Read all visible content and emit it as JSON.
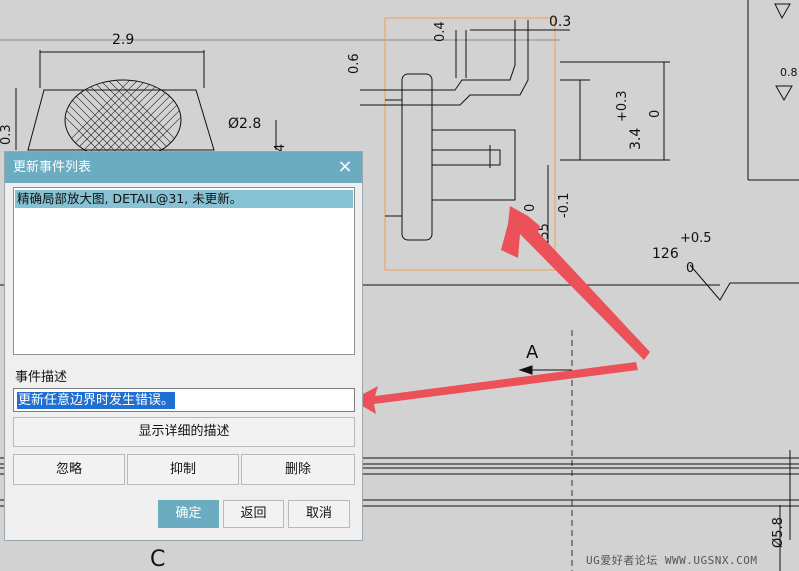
{
  "drawing": {
    "dim_top_width": "2.9",
    "dim_diameter_28": "Ø2.8",
    "dim_03_left": "0.3",
    "dim_04_right": "4",
    "dim_06": "0.6",
    "dim_04": "0.4",
    "dim_03": "0.3",
    "dim_34": "3.4",
    "tol_plus03": "+0.3",
    "tol_zero_a": "0",
    "tol_zero_b": "0",
    "tol_minus01": "-0.1",
    "dim_255": "2.55",
    "dim_126": "126",
    "tol_plus05": "+0.5",
    "tol_zero_c": "0",
    "dim_08": "0.8",
    "section_a": "A",
    "dim_58": "Ø5.8",
    "label_c": "C"
  },
  "dialog": {
    "title": "更新事件列表",
    "close_glyph": "×",
    "events": [
      {
        "text": "精确局部放大图, DETAIL@31, 未更新。"
      }
    ],
    "desc_label": "事件描述",
    "desc_value": "更新任意边界时发生错误。",
    "show_details_label": "显示详细的描述",
    "ignore_label": "忽略",
    "suppress_label": "抑制",
    "delete_label": "删除",
    "ok_label": "确定",
    "back_label": "返回",
    "cancel_label": "取消"
  },
  "watermark": "UG爱好者论坛 WWW.UGSNX.COM",
  "colors": {
    "titlebar": "#6bacc1",
    "selection": "#86c2d4",
    "text_selection": "#1f6fd1",
    "arrow": "#ec5159",
    "highlight_box": "#f0a050"
  }
}
